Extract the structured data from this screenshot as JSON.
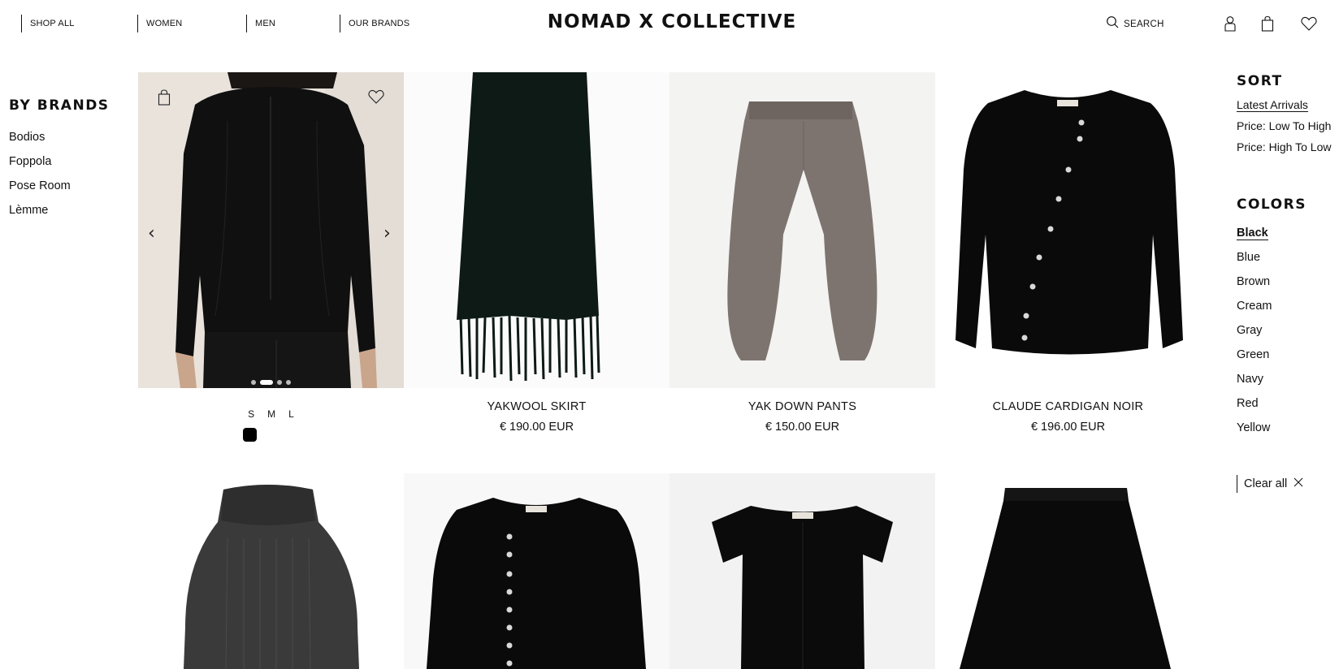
{
  "header": {
    "nav": [
      "SHOP ALL",
      "WOMEN",
      "MEN",
      "OUR BRANDS"
    ],
    "logo": "NOMAD X COLLECTIVE",
    "search_label": "SEARCH",
    "icons": [
      "search-icon",
      "account-icon",
      "bag-icon",
      "wishlist-icon"
    ]
  },
  "brands": {
    "title": "BY BRANDS",
    "items": [
      "Bodios",
      "Foppola",
      "Pose Room",
      "Lèmme"
    ]
  },
  "sort": {
    "title": "SORT",
    "items": [
      "Latest Arrivals",
      "Price: Low To High",
      "Price: High To Low"
    ],
    "active": "Latest Arrivals"
  },
  "colors": {
    "title": "COLORS",
    "items": [
      "Black",
      "Blue",
      "Brown",
      "Cream",
      "Gray",
      "Green",
      "Navy",
      "Red",
      "Yellow"
    ],
    "active": "Black"
  },
  "clear_all": "Clear all",
  "products": [
    {
      "name": "",
      "price": "",
      "sizes": [
        "S",
        "M",
        "L"
      ],
      "swatch_color": "#000000",
      "carousel_dots": 4,
      "carousel_active": 2
    },
    {
      "name": "YAKWOOL SKIRT",
      "price": "€ 190.00 EUR"
    },
    {
      "name": "YAK DOWN PANTS",
      "price": "€ 150.00 EUR"
    },
    {
      "name": "CLAUDE CARDIGAN NOIR",
      "price": "€ 196.00 EUR"
    }
  ],
  "colors_palette": {
    "text": "#111111",
    "image_bg_light": "#f4f4f2",
    "garment_black": "#0c0c0c",
    "garment_gray": "#7d7470",
    "knit_charcoal": "#3a3a3a"
  }
}
